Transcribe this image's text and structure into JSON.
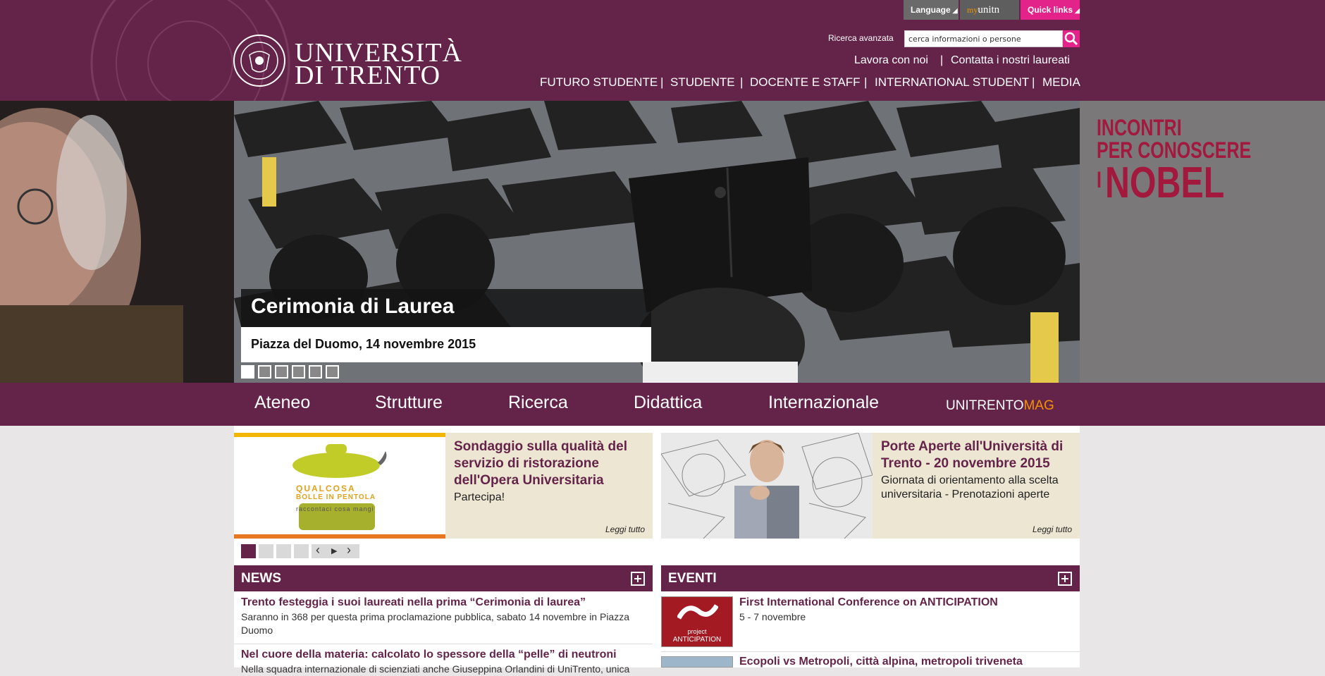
{
  "header": {
    "logo_line1": "UNIVERSITÀ",
    "logo_line2": "DI TRENTO",
    "util_tabs": {
      "language": "Language",
      "myunitn_prefix": "my",
      "myunitn_suffix": "unitn",
      "quick_links": "Quick links"
    },
    "search": {
      "advanced_label": "Ricerca avanzata",
      "value": "cerca informazioni o persone"
    },
    "secondary_links": [
      "Lavora con noi",
      "Contatta i nostri laureati"
    ],
    "main_nav": [
      "FUTURO STUDENTE",
      "STUDENTE",
      "DOCENTE E STAFF",
      "INTERNATIONAL STUDENT",
      "MEDIA"
    ]
  },
  "hero": {
    "title": "Cerimonia di Laurea",
    "subtitle": "Piazza del Duomo, 14 novembre 2015",
    "side_banner": [
      "INCONTRI",
      "PER CONOSCERE",
      "I",
      "NOBEL"
    ],
    "slide_count": 6,
    "active_slide": 1
  },
  "nav": {
    "items": [
      "Ateneo",
      "Strutture",
      "Ricerca",
      "Didattica",
      "Internazionale"
    ],
    "mag_prefix": "UNITRENTO",
    "mag_suffix": "MAG"
  },
  "promos": [
    {
      "image_line1": "QUALCOSA",
      "image_line2": "BOLLE IN PENTOLA",
      "image_line3": "raccontaci cosa mangi",
      "title": "Sondaggio sulla qualità del servizio di ristorazione dell'Opera Universitaria",
      "desc": "Partecipa!",
      "read_more": "Leggi tutto"
    },
    {
      "title": "Porte Aperte all'Università di Trento - 20 novembre 2015",
      "desc": "Giornata di orientamento alla scelta universitaria - Prenotazioni aperte",
      "read_more": "Leggi tutto"
    }
  ],
  "carousel": {
    "count": 4,
    "active": 1,
    "prev": "‹",
    "play": "▶",
    "next": "›"
  },
  "news": {
    "header": "NEWS",
    "items": [
      {
        "title": "Trento festeggia i suoi laureati nella prima “Cerimonia di laurea”",
        "desc": "Saranno in 368 per questa prima proclamazione pubblica, sabato 14 novembre in Piazza Duomo"
      },
      {
        "title": "Nel cuore della materia: calcolato lo spessore della “pelle” di neutroni",
        "desc": "Nella squadra internazionale di scienziati anche Giuseppina Orlandini di UniTrento, unica"
      }
    ]
  },
  "events": {
    "header": "EVENTI",
    "items": [
      {
        "thumb_line1": "project",
        "thumb_line2": "ANTICIPATION",
        "title": "First International Conference on ANTICIPATION",
        "desc": "5 - 7 novembre"
      },
      {
        "title": "Ecopoli vs Metropoli, città alpina, metropoli triveneta",
        "desc": ""
      }
    ]
  },
  "colors": {
    "brand": "#64244a",
    "accent": "#e3238a",
    "mag": "#f39200"
  }
}
